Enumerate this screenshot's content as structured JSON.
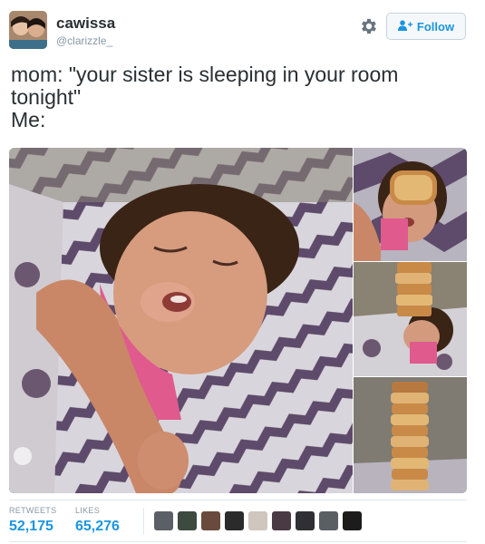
{
  "user": {
    "display_name": "cawissa",
    "handle": "@clarizzle_"
  },
  "actions": {
    "follow_label": "Follow",
    "settings_icon": "gear-icon",
    "follow_icon": "add-user-icon"
  },
  "tweet": {
    "lines": [
      "mom: \"your sister is sleeping in your room",
      "tonight\"",
      "Me:"
    ]
  },
  "stats": {
    "retweets_label": "RETWEETS",
    "retweets_value": "52,175",
    "likes_label": "LIKES",
    "likes_value": "65,276"
  },
  "liked_by_count_shown": 9,
  "colors": {
    "accent": "#1b95e0",
    "text": "#292f33",
    "muted": "#8899a6",
    "border": "#e1e8ed"
  }
}
